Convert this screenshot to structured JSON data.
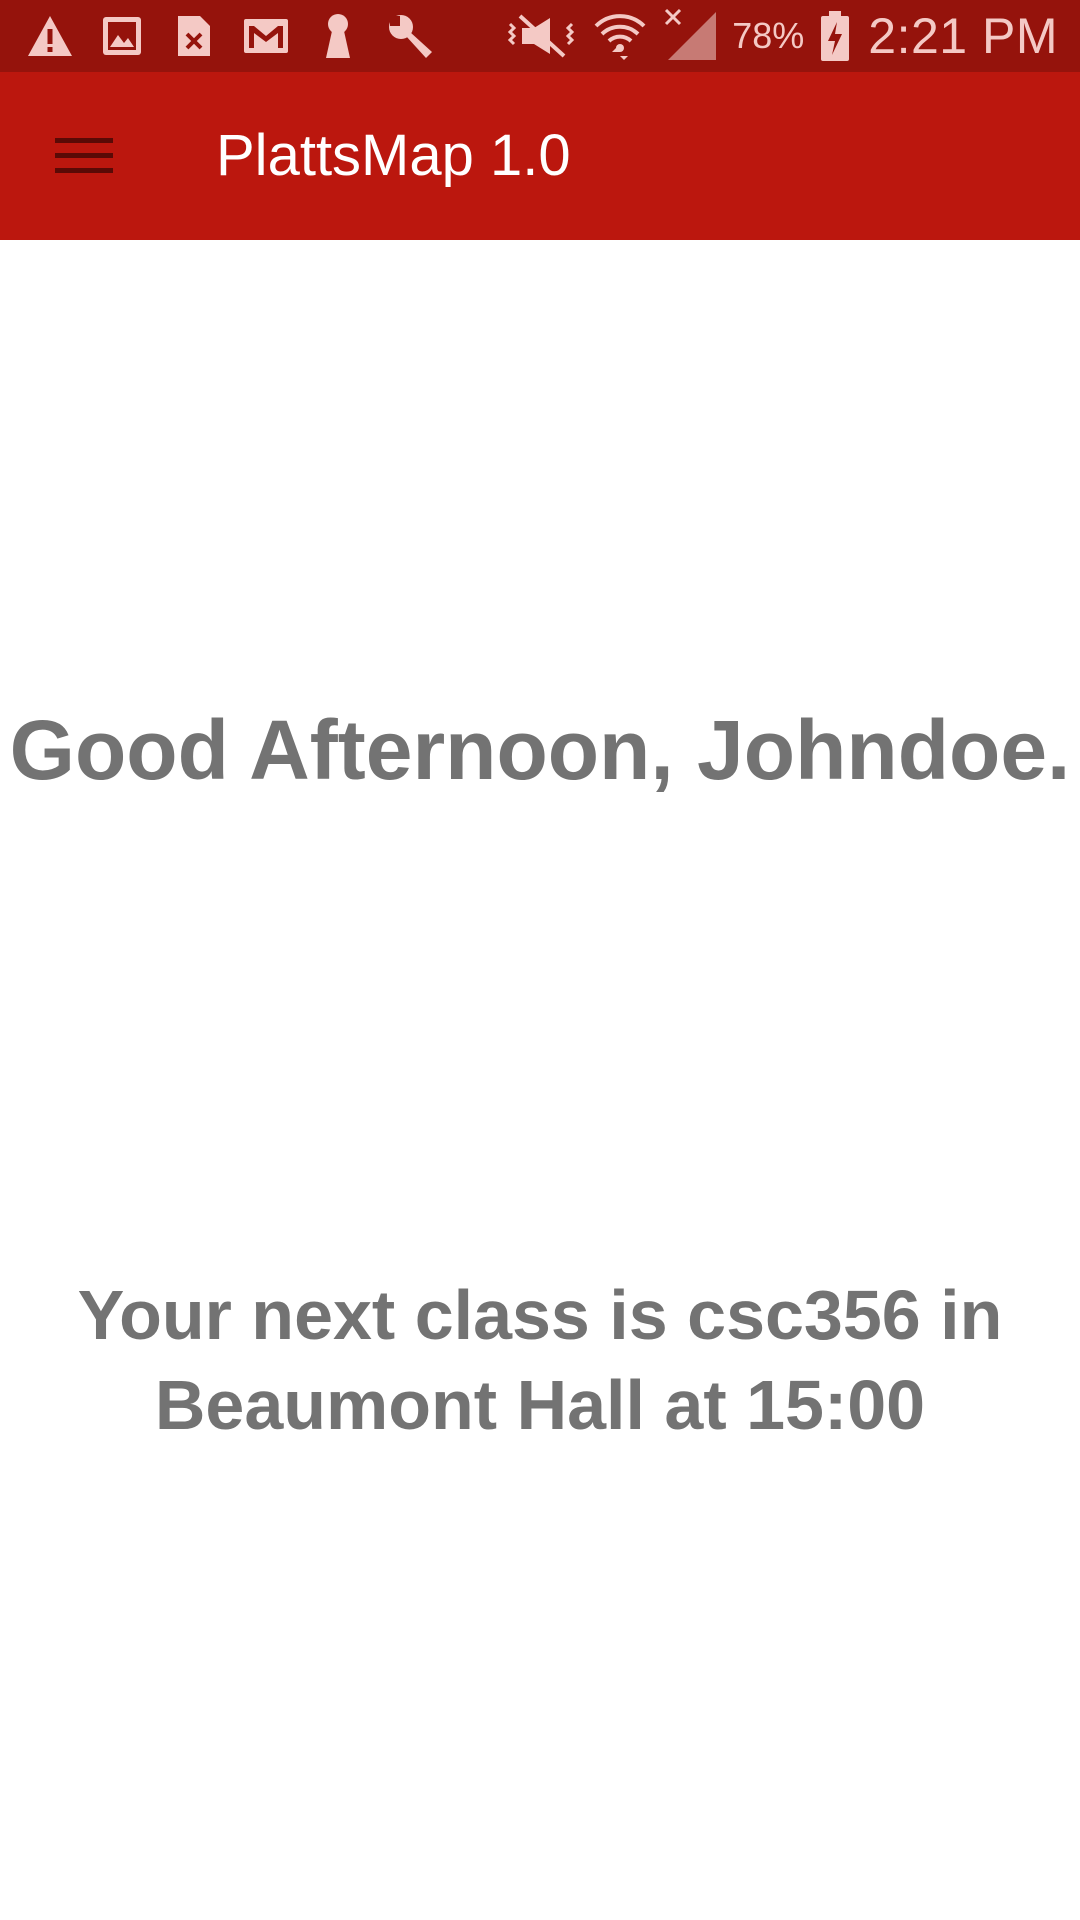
{
  "status_bar": {
    "background": "#95130c",
    "left_icons": [
      "warning-icon",
      "image-icon",
      "sim-error-icon",
      "gmail-icon",
      "keyhole-icon",
      "wrench-icon"
    ],
    "right_icons": [
      "mute-vibrate-icon",
      "wifi-icon",
      "signal-icon",
      "battery-charging-icon"
    ],
    "battery_percent": "78%",
    "time": "2:21 PM"
  },
  "app_bar": {
    "background": "#bb170e",
    "menu_icon": "hamburger-menu-icon",
    "title": "PlattsMap 1.0"
  },
  "main": {
    "greeting": "Good Afternoon, Johndoe.",
    "next_class": "Your next class is csc356 in Beaumont Hall at 15:00",
    "text_color": "#737373"
  }
}
